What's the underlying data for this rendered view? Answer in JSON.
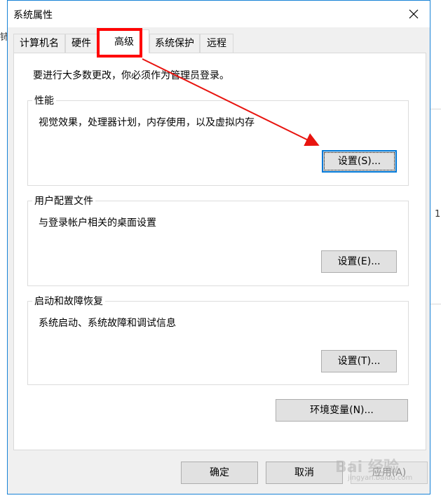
{
  "window": {
    "title": "系统属性"
  },
  "tabs": [
    {
      "label": "计算机名"
    },
    {
      "label": "硬件"
    },
    {
      "label": "高级"
    },
    {
      "label": "系统保护"
    },
    {
      "label": "远程"
    }
  ],
  "active_tab": "高级",
  "notice": "要进行大多数更改，你必须作为管理员登录。",
  "groups": {
    "performance": {
      "title": "性能",
      "description": "视觉效果，处理器计划，内存使用，以及虚拟内存",
      "button": "设置(S)..."
    },
    "user_profiles": {
      "title": "用户配置文件",
      "description": "与登录帐户相关的桌面设置",
      "button": "设置(E)..."
    },
    "startup_recovery": {
      "title": "启动和故障恢复",
      "description": "系统启动、系统故障和调试信息",
      "button": "设置(T)..."
    }
  },
  "env_button": "环境变量(N)...",
  "footer": {
    "ok": "确定",
    "cancel": "取消",
    "apply": "应用(A)"
  },
  "background": {
    "left_fragment": "铈",
    "right_fragment": "1."
  },
  "watermark": {
    "text": "Bai 经验",
    "sub": "jingyan.baidu.com"
  },
  "colors": {
    "accent": "#0078d7",
    "annotation": "#ff0000"
  }
}
